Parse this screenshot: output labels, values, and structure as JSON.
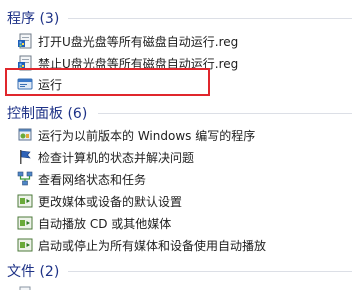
{
  "sections": {
    "programs": {
      "title": "程序 (3)",
      "items": [
        {
          "label": "打开U盘光盘等所有磁盘自动运行.reg",
          "icon": "reg-file-icon"
        },
        {
          "label": "禁止U盘光盘等所有磁盘自动运行.reg",
          "icon": "reg-file-icon"
        },
        {
          "label": "运行",
          "icon": "run-icon"
        }
      ]
    },
    "control_panel": {
      "title": "控制面板 (6)",
      "items": [
        {
          "label": "运行为以前版本的 Windows 编写的程序",
          "icon": "compatibility-icon"
        },
        {
          "label": "检查计算机的状态并解决问题",
          "icon": "action-center-flag-icon"
        },
        {
          "label": "查看网络状态和任务",
          "icon": "network-icon"
        },
        {
          "label": "更改媒体或设备的默认设置",
          "icon": "autoplay-icon"
        },
        {
          "label": "自动播放 CD 或其他媒体",
          "icon": "autoplay-icon"
        },
        {
          "label": "启动或停止为所有媒体和设备使用自动播放",
          "icon": "autoplay-icon"
        }
      ]
    },
    "files": {
      "title": "文件 (2)"
    }
  },
  "colors": {
    "section_title": "#1e3287",
    "highlight_border": "#e0262c"
  }
}
